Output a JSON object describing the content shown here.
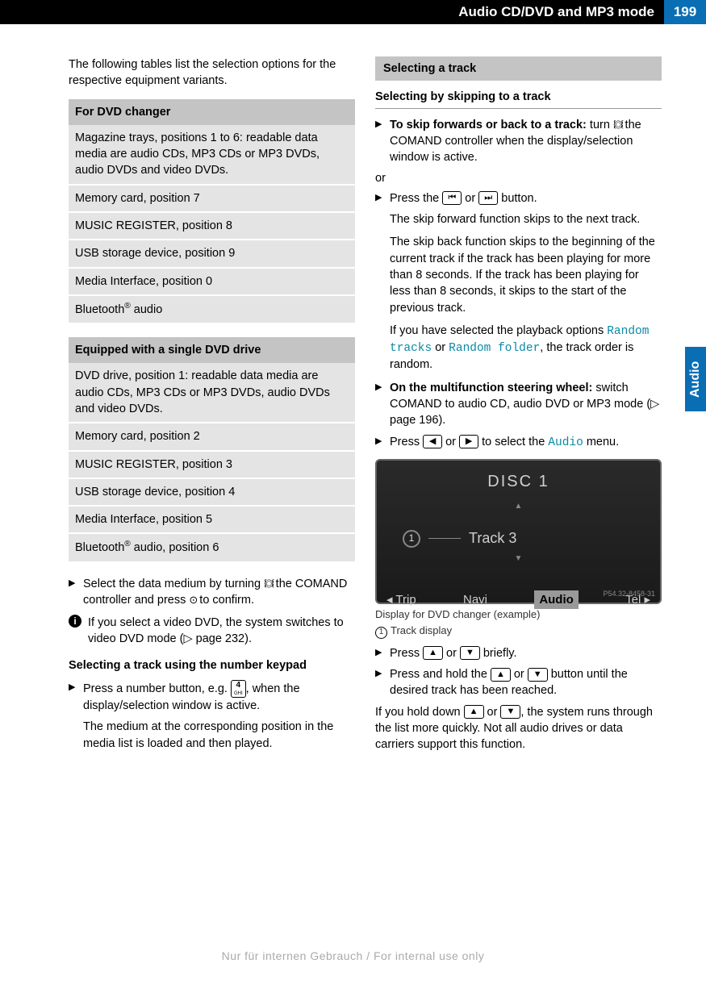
{
  "header": {
    "title": "Audio CD/DVD and MP3 mode",
    "page": "199"
  },
  "sideTab": "Audio",
  "leftCol": {
    "intro": "The following tables list the selection options for the respective equipment variants.",
    "table1": {
      "header": "For DVD changer",
      "rows": [
        "Magazine trays, positions 1 to 6: readable data media are audio CDs, MP3 CDs or MP3 DVDs, audio DVDs and video DVDs.",
        "Memory card, position 7",
        "MUSIC REGISTER, position 8",
        "USB storage device, position 9",
        "Media Interface, position 0",
        "Bluetooth® audio"
      ]
    },
    "table2": {
      "header": "Equipped with a single DVD drive",
      "rows": [
        "DVD drive, position 1: readable data media are audio CDs, MP3 CDs or MP3 DVDs, audio DVDs and video DVDs.",
        "Memory card, position 2",
        "MUSIC REGISTER, position 3",
        "USB storage device, position 4",
        "Media Interface, position 5",
        "Bluetooth® audio, position 6"
      ]
    },
    "step_select": "Select the data medium by turning ",
    "step_select2": " the COMAND controller and press ",
    "step_select3": " to confirm.",
    "info_dvd": "If you select a video DVD, the system switches to video DVD mode (▷ page 232).",
    "keypad_heading": "Selecting a track using the number keypad",
    "keypad_step1a": "Press a number button, e.g. ",
    "keypad_button": "4\nGHI",
    "keypad_step1b": ", when the display/selection window is active.",
    "keypad_step1c": "The medium at the corresponding position in the media list is loaded and then played."
  },
  "rightCol": {
    "sectionBar": "Selecting a track",
    "sectionTitle": "Selecting by skipping to a track",
    "skip_bold": "To skip forwards or back to a track:",
    "skip_rest1": " turn ",
    "skip_rest2": " the COMAND controller when the display/selection window is active.",
    "or": "or",
    "press1": "Press the ",
    "press_or": " or ",
    "press2": " button.",
    "press_extra1": "The skip forward function skips to the next track.",
    "press_extra2": "The skip back function skips to the beginning of the current track if the track has been playing for more than 8 seconds. If the track has been playing for less than 8 seconds, it skips to the start of the previous track.",
    "press_extra3a": "If you have selected the playback options ",
    "rand1": "Random tracks",
    "rand_or": " or ",
    "rand2": "Random folder",
    "press_extra3b": ", the track order is random.",
    "mfw_bold": "On the multifunction steering wheel:",
    "mfw_rest": " switch COMAND to audio CD, audio DVD or MP3 mode (▷ page 196).",
    "press_arrow1": "Press ",
    "press_arrow_or": " or ",
    "press_arrow2": " to select the ",
    "audio_cyan": "Audio",
    "press_arrow3": " menu.",
    "display": {
      "disc": "DISC 1",
      "trackNum": "1",
      "trackLabel": "Track 3",
      "menu": [
        "◂ Trip",
        "Navi",
        "Audio",
        "Tel ▸"
      ],
      "ref": "P54.32-8458-31"
    },
    "caption1": "Display for DVD changer (example)",
    "caption2": "Track display",
    "brief1": "Press ",
    "brief_or": " or ",
    "brief2": " briefly.",
    "hold1": "Press and hold the ",
    "hold_or": " or ",
    "hold2": " button until the desired track has been reached.",
    "holddown1": "If you hold down ",
    "holddown_or": " or ",
    "holddown2": ", the system runs through the list more quickly. Not all audio drives or data carriers support this function."
  },
  "footer": "Nur für internen Gebrauch / For internal use only"
}
